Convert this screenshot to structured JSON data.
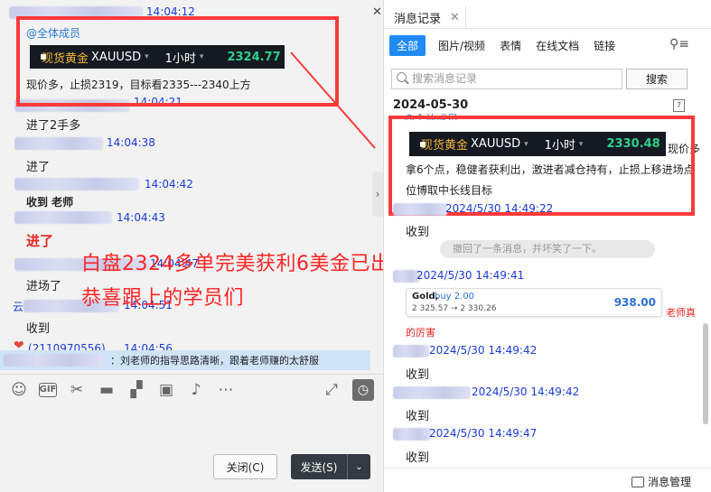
{
  "left_chat": {
    "messages": [
      {
        "time": "14:04:12"
      },
      {
        "mention": "@全体成员",
        "ticker": {
          "name": "现货黄金",
          "symbol": "XAUUSD",
          "interval": "1小时",
          "price": "2324.77"
        },
        "text": "现价多，止损2319，目标看2335---2340上方"
      },
      {
        "time": "14:04:21"
      },
      {
        "text": "进了2手多"
      },
      {
        "time": "14:04:38"
      },
      {
        "text": "进了"
      },
      {
        "time": "14:04:42"
      },
      {
        "text": "收到  老师"
      },
      {
        "time": "14:04:43"
      },
      {
        "text": "进了"
      },
      {
        "time": "14:04:47"
      },
      {
        "text": "进场了"
      },
      {
        "time": "14:04:51"
      },
      {
        "text": "收到"
      },
      {
        "id_fragment": "2110970556",
        "time": "14:04:56"
      }
    ],
    "quote_bar": "：刘老师的指导思路清晰，跟着老师赚的太舒服",
    "overlay_line1": "白盘2324多单完美获利6美金已出局",
    "overlay_line2": "恭喜跟上的学员们",
    "buttons": {
      "close": "关闭(C)",
      "send": "发送(S)"
    },
    "toolbar_icons": [
      "emoji-icon",
      "gif-icon",
      "scissors-icon",
      "folder-icon",
      "chart-icon",
      "image-icon",
      "bell-icon",
      "more-icon",
      "expand-icon",
      "history-icon"
    ]
  },
  "history": {
    "tab_title": "消息记录",
    "filters": [
      "全部",
      "图片/视频",
      "表情",
      "在线文档",
      "链接"
    ],
    "search_placeholder": "搜索消息记录",
    "search_button": "搜索",
    "date": "2024-05-30",
    "calendar_day": "7",
    "entry1": {
      "mention": "@全体成员",
      "ticker": {
        "name": "现货黄金",
        "symbol": "XAUUSD",
        "interval": "1小时",
        "price": "2330.48"
      },
      "text_a": "现价多",
      "text_b": "拿6个点，稳健者获利出，激进者减仓持有，止损上移进场点",
      "text_c": "位博取中长线目标"
    },
    "entries": [
      {
        "time": "2024/5/30 14:49:22",
        "text": "收到"
      },
      {
        "recall": "撤回了一条消息，并坏笑了一下。"
      },
      {
        "time": "2024/5/30 14:49:41"
      },
      {
        "trade": {
          "symbol": "Gold,",
          "side": "buy 2.00",
          "range": "2 325.57 → 2 330.26",
          "profit": "938.00"
        },
        "caption_a": "老师真",
        "caption_b": "的厉害"
      },
      {
        "time": "2024/5/30 14:49:42",
        "text": "收到"
      },
      {
        "time": "2024/5/30 14:49:42",
        "text": "收到"
      },
      {
        "time": "2024/5/30 14:49:47",
        "text": "收到"
      }
    ],
    "footer": "消息管理"
  },
  "colors": {
    "accent": "#1f8bf0",
    "timestamp": "#1b3cd6",
    "highlight_red": "#ff3a3a",
    "ticker_bg": "#151a22",
    "ticker_price": "#2ecf8b"
  }
}
